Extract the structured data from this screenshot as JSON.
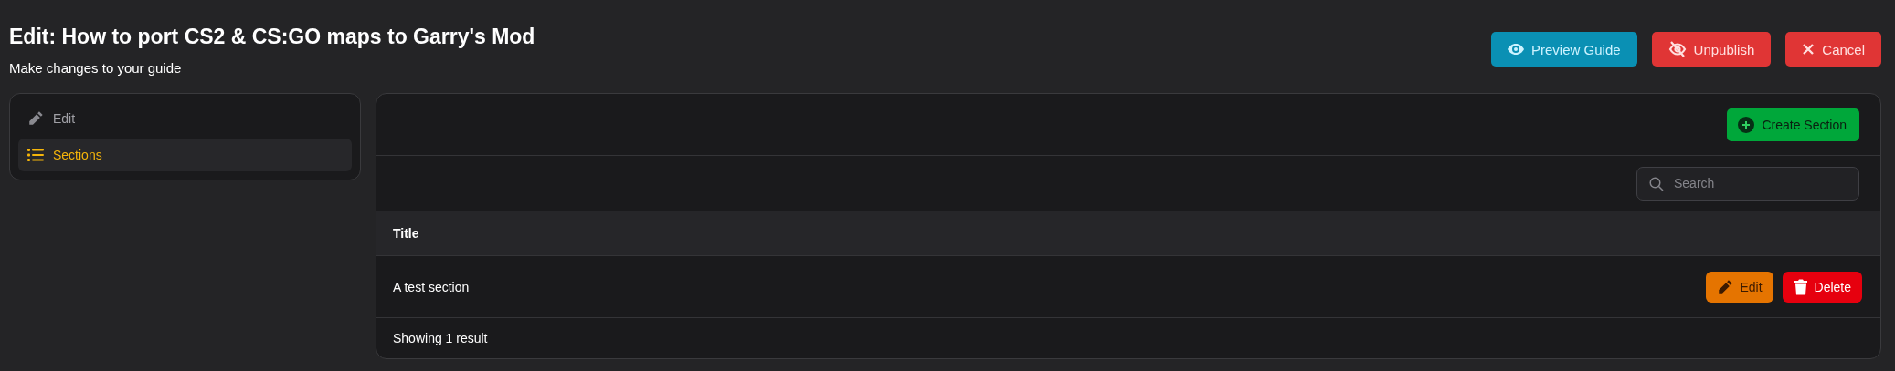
{
  "header": {
    "title": "Edit: How to port CS2 & CS:GO maps to Garry's Mod",
    "subtitle": "Make changes to your guide",
    "actions": [
      {
        "label": "Preview Guide",
        "kind": "preview"
      },
      {
        "label": "Unpublish",
        "kind": "unpublish"
      },
      {
        "label": "Cancel",
        "kind": "cancel"
      }
    ]
  },
  "sidebar": {
    "items": [
      {
        "label": "Edit",
        "kind": "pencil",
        "selected": false
      },
      {
        "label": "Sections",
        "kind": "list",
        "selected": true
      }
    ]
  },
  "panel": {
    "create_button": "Create Section",
    "search": {
      "placeholder": "Search"
    },
    "table": {
      "columns": [
        "Title"
      ],
      "rows": [
        {
          "title": "A test section",
          "actions": [
            {
              "label": "Edit",
              "kind": "edit"
            },
            {
              "label": "Delete",
              "kind": "delete"
            }
          ]
        }
      ]
    },
    "footer": "Showing 1 result"
  }
}
